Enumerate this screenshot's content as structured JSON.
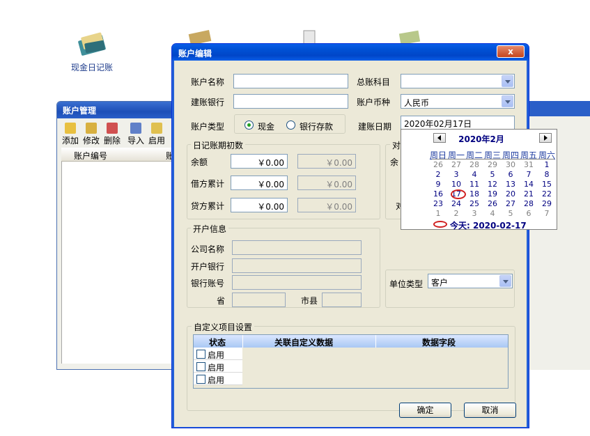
{
  "desktop": {
    "icon_label": "现金日记账"
  },
  "bg_window": {
    "title": "账户管理",
    "toolbar": [
      "添加",
      "修改",
      "删除",
      "导入",
      "启用"
    ],
    "grid_header": [
      "账户编号",
      "账"
    ]
  },
  "dialog": {
    "title": "账户编辑",
    "close_label": "x",
    "labels": {
      "account_name": "账户名称",
      "ledger_subject": "总账科目",
      "bank": "建账银行",
      "currency": "账户币种",
      "account_type": "账户类型",
      "start_date": "建账日期"
    },
    "values": {
      "account_name": "",
      "ledger_subject": "",
      "bank": "",
      "currency": "人民币",
      "start_date": "2020年02月17日"
    },
    "account_type": {
      "options": [
        "现金",
        "银行存款"
      ],
      "selected": "现金"
    },
    "initial_group": {
      "title": "日记账期初数",
      "rows": [
        {
          "label": "余额",
          "value": "￥0.00",
          "value_ro": "￥0.00"
        },
        {
          "label": "借方累计",
          "value": "￥0.00",
          "value_ro": "￥0.00"
        },
        {
          "label": "贷方累计",
          "value": "￥0.00",
          "value_ro": "￥0.00"
        }
      ]
    },
    "reconcile_group": {
      "title": "对",
      "label_balance": "余",
      "label_reconcile": "对"
    },
    "open_group": {
      "title": "开户信息",
      "company": "公司名称",
      "bank": "开户银行",
      "account_no": "银行账号",
      "province": "省",
      "city": "市县"
    },
    "unit_type": {
      "label": "单位类型",
      "value": "客户"
    },
    "custom_group": {
      "title": "自定义项目设置",
      "headers": [
        "状态",
        "关联自定义数据",
        "数据字段"
      ],
      "rows": [
        "启用",
        "启用",
        "启用"
      ]
    },
    "buttons": {
      "ok": "确定",
      "cancel": "取消"
    }
  },
  "calendar": {
    "title": "2020年2月",
    "weekdays": [
      "周日",
      "周一",
      "周二",
      "周三",
      "周四",
      "周五",
      "周六"
    ],
    "weeks": [
      [
        "26",
        "27",
        "28",
        "29",
        "30",
        "31",
        "1"
      ],
      [
        "2",
        "3",
        "4",
        "5",
        "6",
        "7",
        "8"
      ],
      [
        "9",
        "10",
        "11",
        "12",
        "13",
        "14",
        "15"
      ],
      [
        "16",
        "17",
        "18",
        "19",
        "20",
        "21",
        "22"
      ],
      [
        "23",
        "24",
        "25",
        "26",
        "27",
        "28",
        "29"
      ],
      [
        "1",
        "2",
        "3",
        "4",
        "5",
        "6",
        "7"
      ]
    ],
    "selected_day": "17",
    "today_text": "今天: 2020-02-17"
  }
}
